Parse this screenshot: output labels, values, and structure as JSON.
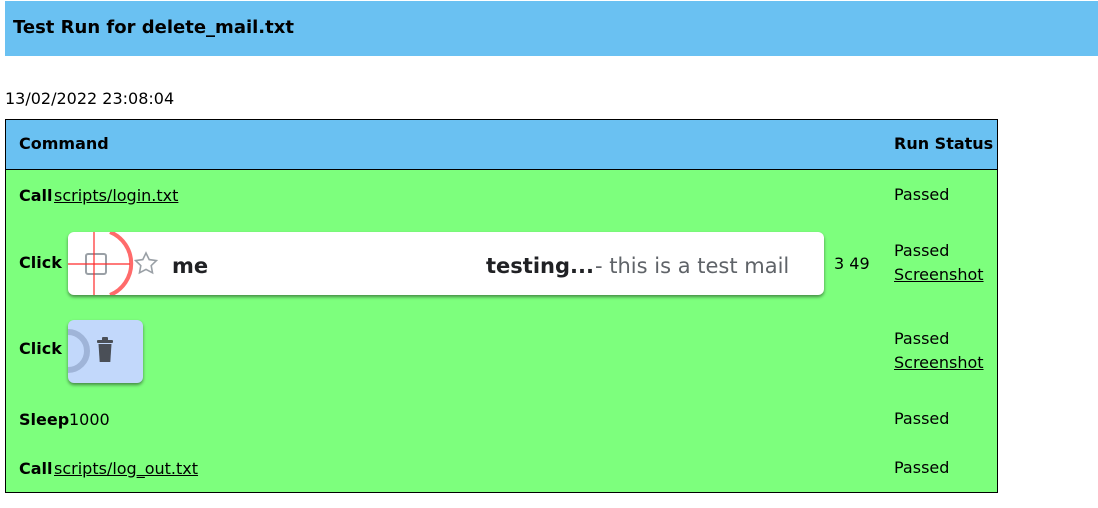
{
  "header": {
    "title": "Test Run for delete_mail.txt"
  },
  "run": {
    "timestamp": "13/02/2022 23:08:04"
  },
  "table": {
    "columns": {
      "command": "Command",
      "status": "Run Status"
    },
    "rows": [
      {
        "command": "Call",
        "argument": "scripts/login.txt",
        "status": "Passed"
      },
      {
        "command": "Click",
        "coords": "3 49",
        "status": "Passed",
        "status_link": "Screenshot",
        "thumbnail": {
          "sender": "me",
          "subject": "testing...",
          "snippet": " - this is a test mail"
        }
      },
      {
        "command": "Click",
        "status": "Passed",
        "status_link": "Screenshot",
        "thumbnail": {
          "icon": "trash-icon"
        }
      },
      {
        "command": "Sleep",
        "argument": "1000",
        "status": "Passed"
      },
      {
        "command": "Call",
        "argument": "scripts/log_out.txt",
        "status": "Passed"
      }
    ]
  },
  "colors": {
    "header_bg": "#6ac1f2",
    "row_bg": "#7dff7d",
    "marker": "#ff0000"
  }
}
